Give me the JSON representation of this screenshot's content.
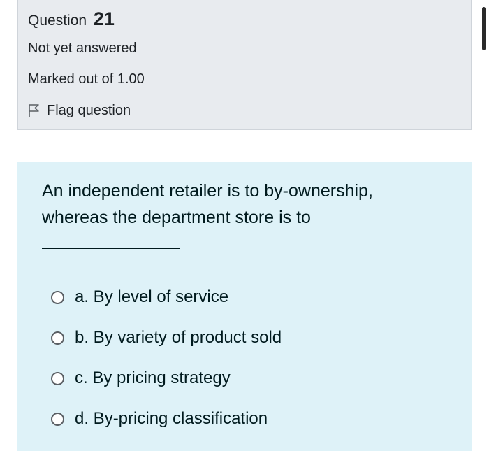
{
  "question_info": {
    "label": "Question",
    "number": "21",
    "status": "Not yet answered",
    "marks": "Marked out of 1.00",
    "flag_label": "Flag question",
    "flag_icon": "flag-outline-icon"
  },
  "question": {
    "text": "An independent retailer is to by-ownership, whereas the department store is to",
    "answers": [
      {
        "label": "a. By level of service",
        "selected": false
      },
      {
        "label": "b. By variety of product sold",
        "selected": false
      },
      {
        "label": "c. By pricing strategy",
        "selected": false
      },
      {
        "label": "d. By-pricing classification",
        "selected": false
      }
    ]
  },
  "colors": {
    "info_background": "#e8ebef",
    "content_background": "#def2f8",
    "text": "#001a1e"
  }
}
